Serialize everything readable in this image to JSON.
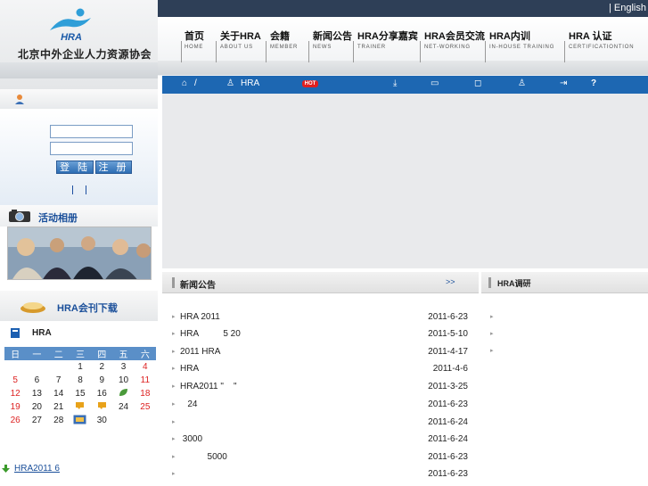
{
  "topbar": {
    "language_link": "| English"
  },
  "logo": {
    "mark_text": "HRA",
    "org_name": "北京中外企业人力资源协会"
  },
  "nav": [
    {
      "cn": "首页",
      "en": "HOME"
    },
    {
      "cn": "关于HRA",
      "en": "ABOUT US"
    },
    {
      "cn": "会籍",
      "en": "MEMBER"
    },
    {
      "cn": "新闻公告",
      "en": "NEWS"
    },
    {
      "cn": "HRA分享嘉宾",
      "en": "TRAINER"
    },
    {
      "cn": "HRA会员交流",
      "en": "NET-WORKING"
    },
    {
      "cn": "HRA内训",
      "en": "IN-HOUSE TRAINING"
    },
    {
      "cn": "HRA 认证",
      "en": "CERTIFICATIONTION"
    }
  ],
  "toolbar": {
    "home_sep": "/",
    "hra_label": "HRA",
    "hot_badge": "HOT",
    "help": "?"
  },
  "login": {
    "login_button": "登 陆",
    "register_button": "注 册"
  },
  "album": {
    "title": "活动相册"
  },
  "magazine": {
    "title": "HRA会刊下载"
  },
  "calendar": {
    "title": "HRA",
    "weekdays": [
      "日",
      "一",
      "二",
      "三",
      "四",
      "五",
      "六"
    ],
    "weeks": [
      [
        "",
        "",
        "",
        "1",
        "2",
        "3",
        "4"
      ],
      [
        "5",
        "6",
        "7",
        "8",
        "9",
        "10",
        "11"
      ],
      [
        "12",
        "13",
        "14",
        "15",
        "16",
        "",
        "18"
      ],
      [
        "19",
        "20",
        "21",
        "",
        "",
        "24",
        "25"
      ],
      [
        "26",
        "27",
        "28",
        "",
        "30",
        "",
        ""
      ]
    ]
  },
  "bottom_link": "HRA2011 6",
  "news": {
    "title": "新闻公告",
    "more": ">>",
    "items": [
      {
        "title": "HRA 2011",
        "date": "2011-6-23"
      },
      {
        "title": "HRA          5 20",
        "date": "2011-5-10"
      },
      {
        "title": "2011 HRA",
        "date": "2011-4-17"
      },
      {
        "title": "HRA",
        "date": "2011-4-6"
      },
      {
        "title": "HRA2011 \"    \"",
        "date": "2011-3-25"
      },
      {
        "title": "   24",
        "date": "2011-6-23"
      },
      {
        "title": "",
        "date": "2011-6-24"
      },
      {
        "title": " 3000",
        "date": "2011-6-24"
      },
      {
        "title": "           5000",
        "date": "2011-6-23"
      },
      {
        "title": "",
        "date": "2011-6-23"
      }
    ]
  },
  "survey": {
    "title": "HRA调研"
  }
}
